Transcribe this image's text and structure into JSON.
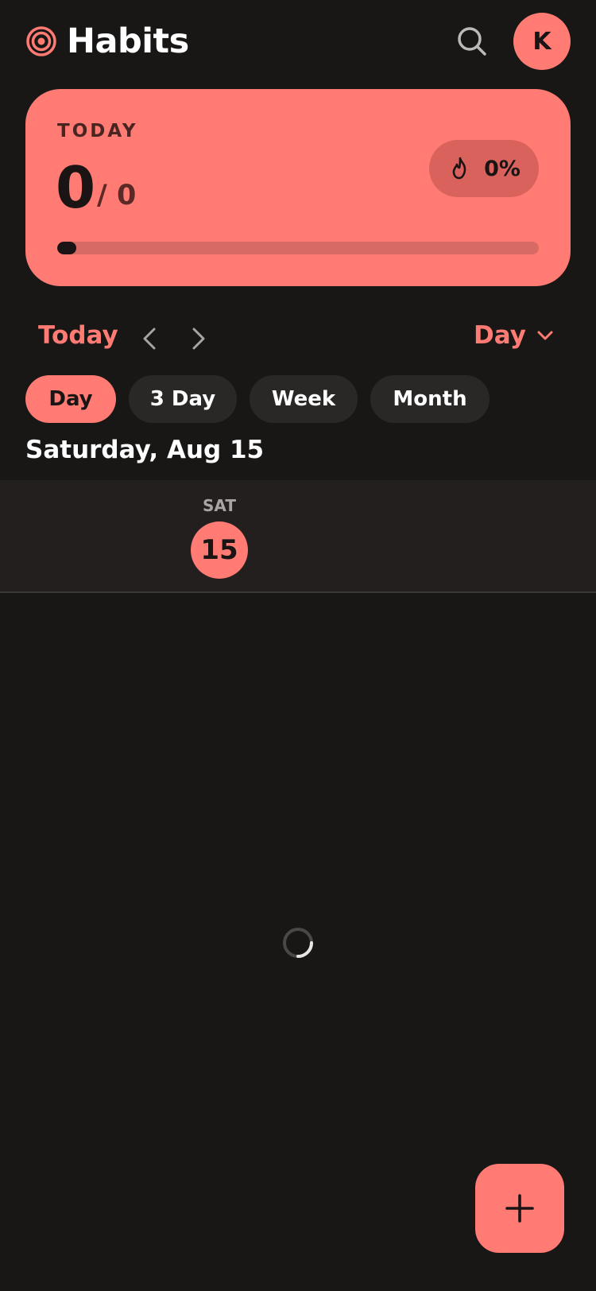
{
  "header": {
    "title": "Habits",
    "logo_icon": "target-icon",
    "search_icon": "search-icon",
    "avatar_initial": "K"
  },
  "today_card": {
    "label": "TODAY",
    "completed": "0",
    "total": "/ 0",
    "streak_icon": "flame-icon",
    "streak_value": "0%",
    "progress": 0,
    "accent_color": "#ff7b73"
  },
  "nav": {
    "today_label": "Today",
    "prev_icon": "chevron-left-icon",
    "next_icon": "chevron-right-icon",
    "view_label": "Day",
    "view_icon": "chevron-down-icon"
  },
  "segments": [
    {
      "label": "Day",
      "active": true
    },
    {
      "label": "3 Day",
      "active": false
    },
    {
      "label": "Week",
      "active": false
    },
    {
      "label": "Month",
      "active": false
    }
  ],
  "date_heading": "Saturday, Aug 15",
  "day_strip": {
    "dow": "SAT",
    "day": "15"
  },
  "loading_icon": "spinner-icon",
  "fab_icon": "plus-icon",
  "colors": {
    "background": "#181716",
    "accent": "#ff7b73",
    "surface": "#2a2827"
  }
}
